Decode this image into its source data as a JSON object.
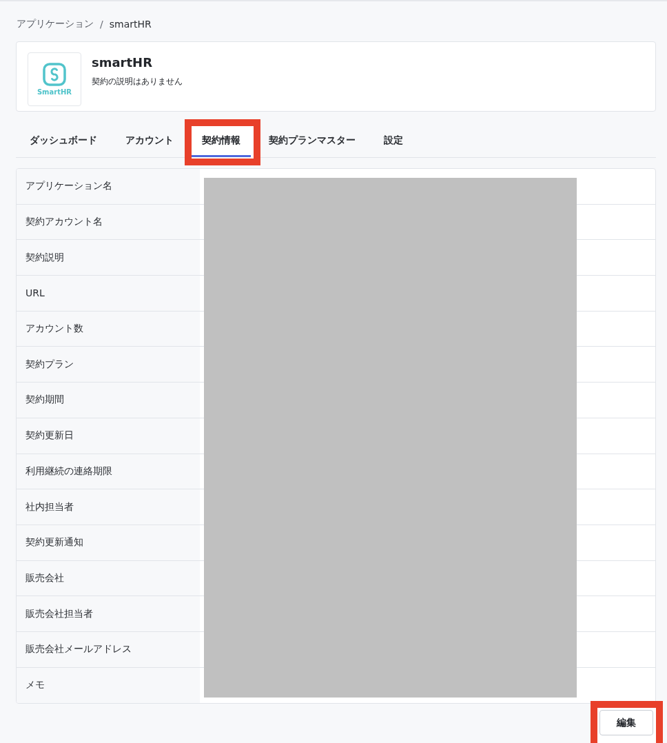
{
  "breadcrumb": {
    "items": [
      "アプリケーション",
      "smartHR"
    ],
    "separator": "/"
  },
  "app": {
    "logo_text": "SmartHR",
    "name": "smartHR",
    "description": "契約の説明はありません"
  },
  "tabs": [
    {
      "label": "ダッシュボード",
      "selected": false,
      "highlighted": false
    },
    {
      "label": "アカウント",
      "selected": false,
      "highlighted": false
    },
    {
      "label": "契約情報",
      "selected": true,
      "highlighted": true
    },
    {
      "label": "契約プランマスター",
      "selected": false,
      "highlighted": false
    },
    {
      "label": "設定",
      "selected": false,
      "highlighted": false
    }
  ],
  "detail_table": {
    "values_redacted": true,
    "rows": [
      {
        "label": "アプリケーション名"
      },
      {
        "label": "契約アカウント名"
      },
      {
        "label": "契約説明"
      },
      {
        "label": "URL"
      },
      {
        "label": "アカウント数"
      },
      {
        "label": "契約プラン"
      },
      {
        "label": "契約期間"
      },
      {
        "label": "契約更新日"
      },
      {
        "label": "利用継続の連絡期限"
      },
      {
        "label": "社内担当者"
      },
      {
        "label": "契約更新通知"
      },
      {
        "label": "販売会社"
      },
      {
        "label": "販売会社担当者"
      },
      {
        "label": "販売会社メールアドレス"
      },
      {
        "label": "メモ"
      }
    ]
  },
  "edit_button": {
    "label": "編集",
    "highlighted": true
  }
}
